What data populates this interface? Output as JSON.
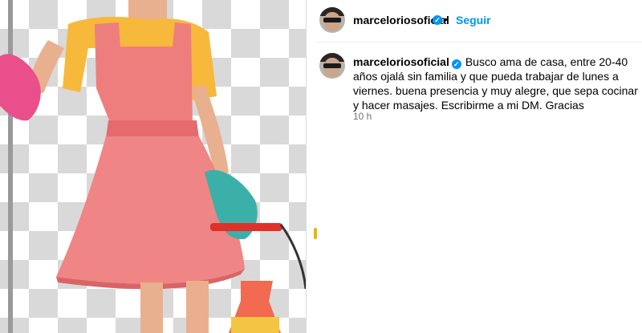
{
  "post": {
    "username": "marceloriosoficial",
    "follow_label": "Seguir",
    "separator": "•",
    "verified_glyph": "✓"
  },
  "comment": {
    "username": "marceloriosoficial",
    "text": "Busco ama de casa, entre 20-40 años ojalá sin familia y que pueda trabajar de lunes a viernes. buena presencia y muy alegre, que sepa cocinar y hacer masajes. Escribirme a mi DM. Gracias",
    "time": "10 h"
  },
  "colors": {
    "accent": "#0095f6",
    "muted": "#737373"
  },
  "icons": {
    "verified": "verified-badge-icon"
  }
}
